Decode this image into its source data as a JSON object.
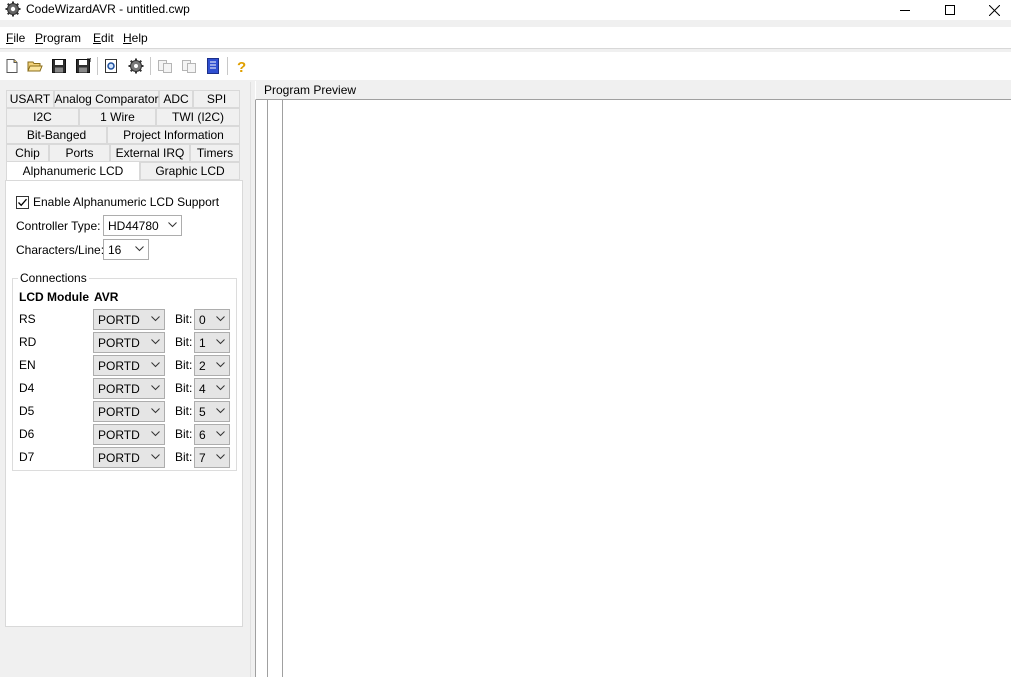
{
  "window": {
    "title": "CodeWizardAVR - untitled.cwp"
  },
  "menu": {
    "items": [
      {
        "accel": "F",
        "rest": "ile"
      },
      {
        "accel": "P",
        "rest": "rogram"
      },
      {
        "accel": "E",
        "rest": "dit"
      },
      {
        "accel": "H",
        "rest": "elp"
      }
    ]
  },
  "toolbar": {
    "icons": [
      "new-file-icon",
      "open-folder-icon",
      "save-icon",
      "save-as-icon",
      "preview-icon",
      "generate-gear-icon",
      "copy-icon",
      "paste-icon",
      "notes-icon",
      "help-icon"
    ]
  },
  "tabs": {
    "row1": [
      "USART",
      "Analog Comparator",
      "ADC",
      "SPI"
    ],
    "row2": [
      "I2C",
      "1 Wire",
      "TWI (I2C)"
    ],
    "row3": [
      "Bit-Banged",
      "Project Information"
    ],
    "row4": [
      "Chip",
      "Ports",
      "External IRQ",
      "Timers"
    ],
    "row5": [
      "Alphanumeric LCD",
      "Graphic LCD"
    ],
    "active": "Alphanumeric LCD"
  },
  "lcd": {
    "enable_label": "Enable Alphanumeric LCD Support",
    "enable_checked": true,
    "controller_label": "Controller Type:",
    "controller_value": "HD44780",
    "chars_label": "Characters/Line:",
    "chars_value": "16",
    "connections_title": "Connections",
    "header_module": "LCD Module",
    "header_avr": "AVR",
    "bit_label": "Bit:",
    "pins": [
      {
        "name": "RS",
        "port": "PORTD",
        "bit": "0"
      },
      {
        "name": "RD",
        "port": "PORTD",
        "bit": "1"
      },
      {
        "name": "EN",
        "port": "PORTD",
        "bit": "2"
      },
      {
        "name": "D4",
        "port": "PORTD",
        "bit": "4"
      },
      {
        "name": "D5",
        "port": "PORTD",
        "bit": "5"
      },
      {
        "name": "D6",
        "port": "PORTD",
        "bit": "6"
      },
      {
        "name": "D7",
        "port": "PORTD",
        "bit": "7"
      }
    ]
  },
  "preview": {
    "title": "Program Preview"
  }
}
